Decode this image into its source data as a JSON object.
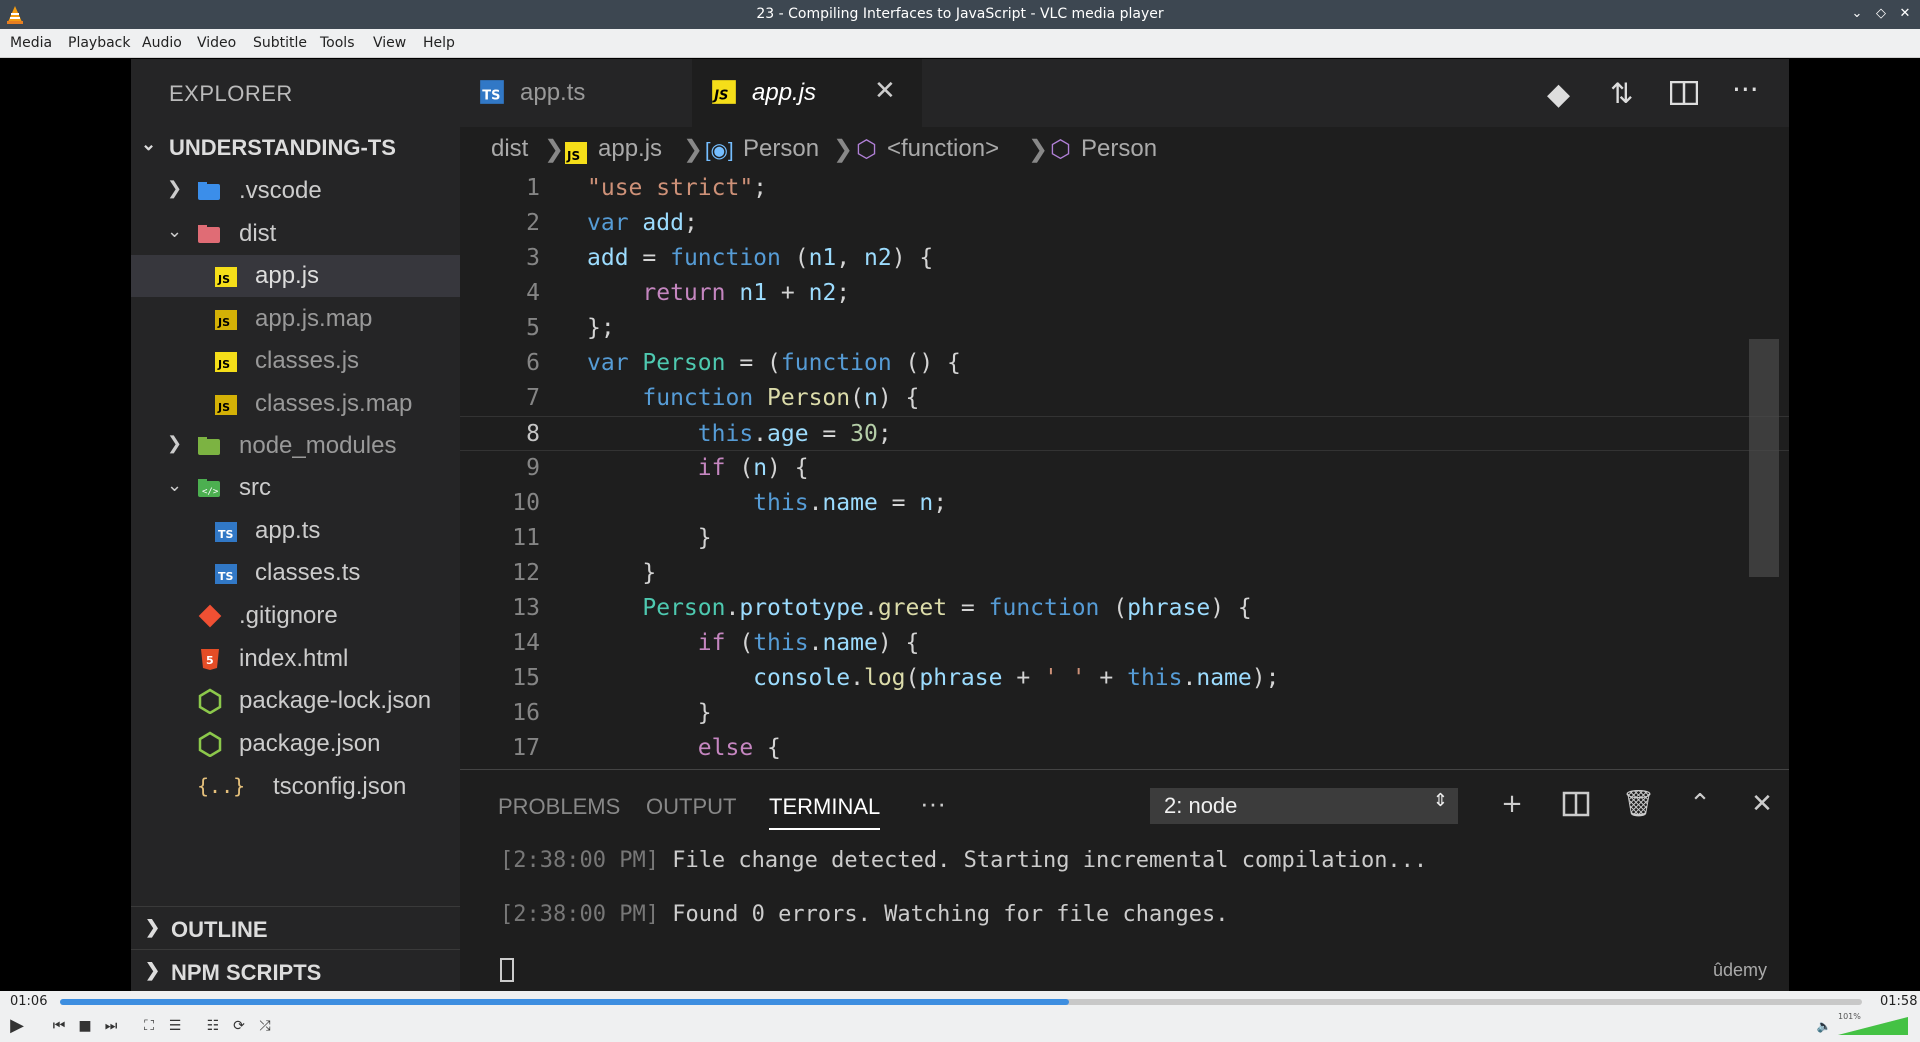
{
  "window": {
    "title": "23 - Compiling Interfaces to JavaScript - VLC media player"
  },
  "menu": [
    "Media",
    "Playback",
    "Audio",
    "Video",
    "Subtitle",
    "Tools",
    "View",
    "Help"
  ],
  "explorer": {
    "header": "EXPLORER",
    "project": "UNDERSTANDING-TS",
    "items": [
      {
        "label": ".vscode",
        "icon": "vscode-folder-icon"
      },
      {
        "label": "dist",
        "icon": "folder-dist-icon"
      },
      {
        "label": "app.js",
        "icon": "js-file-icon"
      },
      {
        "label": "app.js.map",
        "icon": "js-map-file-icon"
      },
      {
        "label": "classes.js",
        "icon": "js-file-icon"
      },
      {
        "label": "classes.js.map",
        "icon": "js-map-file-icon"
      },
      {
        "label": "node_modules",
        "icon": "node-folder-icon"
      },
      {
        "label": "src",
        "icon": "src-folder-icon"
      },
      {
        "label": "app.ts",
        "icon": "ts-file-icon"
      },
      {
        "label": "classes.ts",
        "icon": "ts-file-icon"
      },
      {
        "label": ".gitignore",
        "icon": "git-icon"
      },
      {
        "label": "index.html",
        "icon": "html-icon"
      },
      {
        "label": "package-lock.json",
        "icon": "node-json-icon"
      },
      {
        "label": "package.json",
        "icon": "node-json-icon"
      },
      {
        "label": "tsconfig.json",
        "icon": "json-braces-icon"
      }
    ],
    "outline": "OUTLINE",
    "npm_scripts": "NPM SCRIPTS"
  },
  "tabs": [
    {
      "label": "app.ts",
      "badge": "TS"
    },
    {
      "label": "app.js",
      "badge": "JS"
    }
  ],
  "breadcrumb": {
    "dist": "dist",
    "file": "app.js",
    "sym1": "Person",
    "sym2": "<function>",
    "sym3": "Person"
  },
  "code": {
    "current_line": 8,
    "lines": [
      "1",
      "2",
      "3",
      "4",
      "5",
      "6",
      "7",
      "8",
      "9",
      "10",
      "11",
      "12",
      "13",
      "14",
      "15",
      "16",
      "17"
    ]
  },
  "panel": {
    "tabs": [
      "PROBLEMS",
      "OUTPUT",
      "TERMINAL"
    ],
    "more": "···",
    "terminal_select": "2: node",
    "lines": [
      {
        "ts": "[2:38:00 PM]",
        "msg": " File change detected. Starting incremental compilation..."
      },
      {
        "ts": "[2:38:00 PM]",
        "msg": " Found 0 errors. Watching for file changes."
      }
    ],
    "watermark": "ûdemy"
  },
  "player": {
    "elapsed": "01:06",
    "total": "01:58",
    "progress": 0.56,
    "volume_label": "101%"
  }
}
